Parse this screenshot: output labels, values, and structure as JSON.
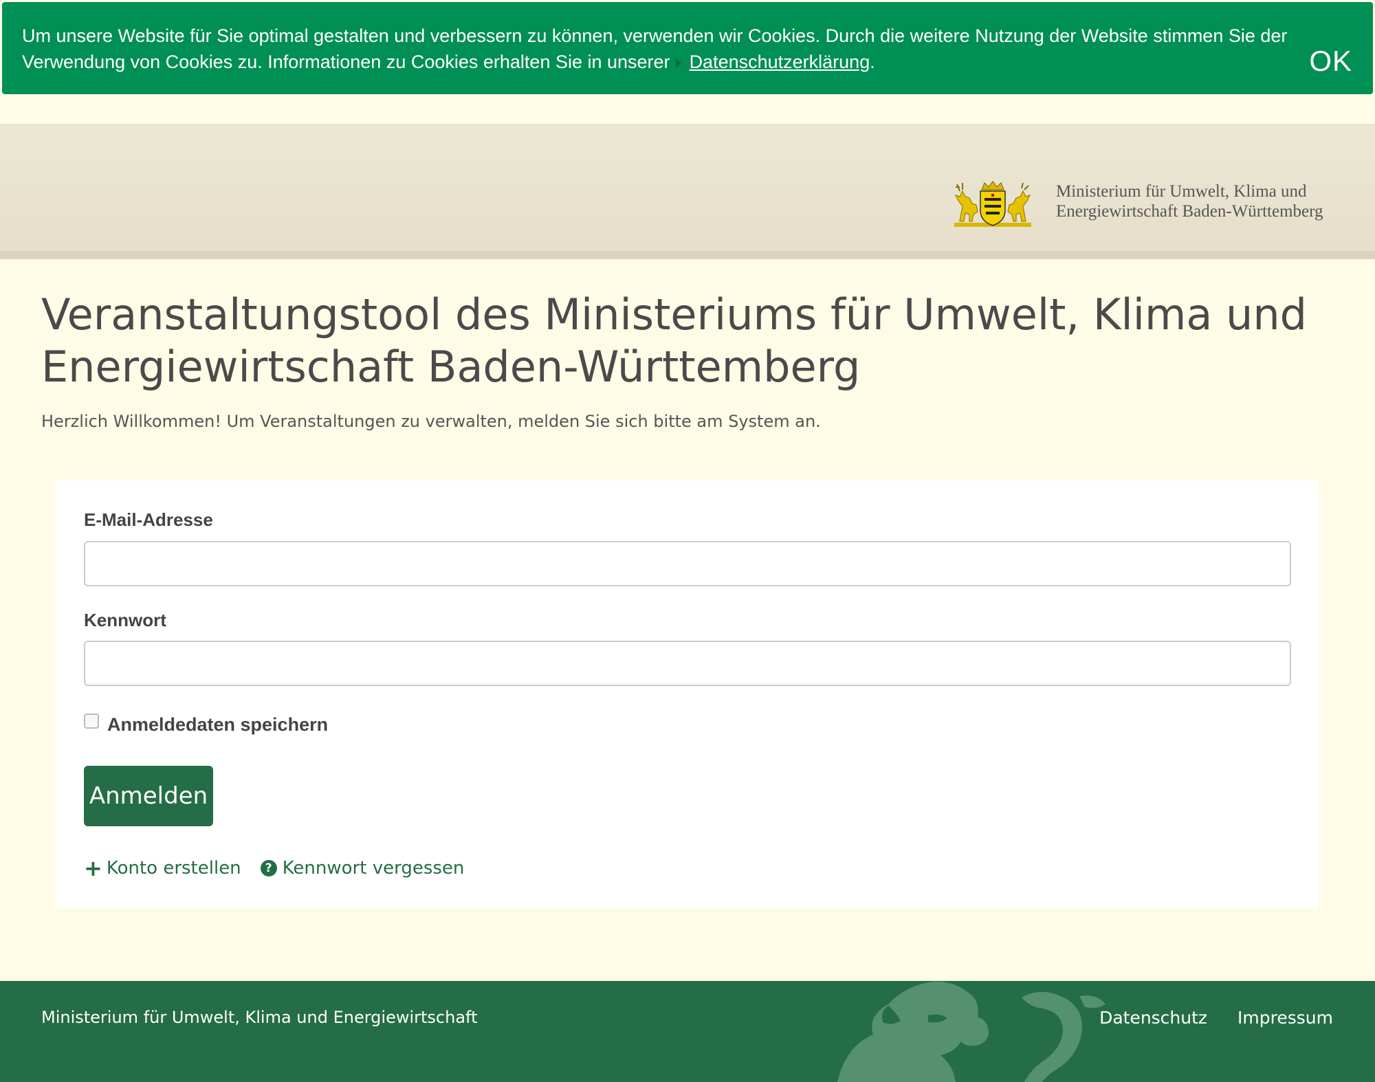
{
  "cookie_banner": {
    "text": "Um unsere Website für Sie optimal gestalten und verbessern zu können, verwenden wir Cookies. Durch die weitere Nutzung der Website stimmen Sie der Verwendung von Cookies zu. Informationen zu Cookies erhalten Sie in unserer",
    "link_label": "Datenschutzerklärung",
    "link_suffix": ".",
    "ok_label": "OK",
    "background_color": "#008f55"
  },
  "header": {
    "logo_icon": "coat-of-arms-icon",
    "logo_line1": "Ministerium für Umwelt, Klima und",
    "logo_line2": "Energiewirtschaft Baden-Württemberg"
  },
  "main": {
    "title": "Veranstaltungstool des Ministeriums für Umwelt, Klima und Energiewirtschaft Baden-Württemberg",
    "intro": "Herzlich Willkommen! Um Veranstaltungen zu verwalten, melden Sie sich bitte am System an."
  },
  "login_form": {
    "email_label": "E-Mail-Adresse",
    "email_value": "",
    "password_label": "Kennwort",
    "password_value": "",
    "remember_label": "Anmeldedaten speichern",
    "remember_checked": false,
    "submit_label": "Anmelden",
    "create_account_label": "Konto erstellen",
    "forgot_password_label": "Kennwort vergessen",
    "accent_color": "#246d47"
  },
  "footer": {
    "ministry_name": "Ministerium für Umwelt, Klima und Energiewirtschaft",
    "links": [
      "Datenschutz",
      "Impressum"
    ],
    "watermark_icon": "lion-icon",
    "background_color": "#246d47"
  }
}
